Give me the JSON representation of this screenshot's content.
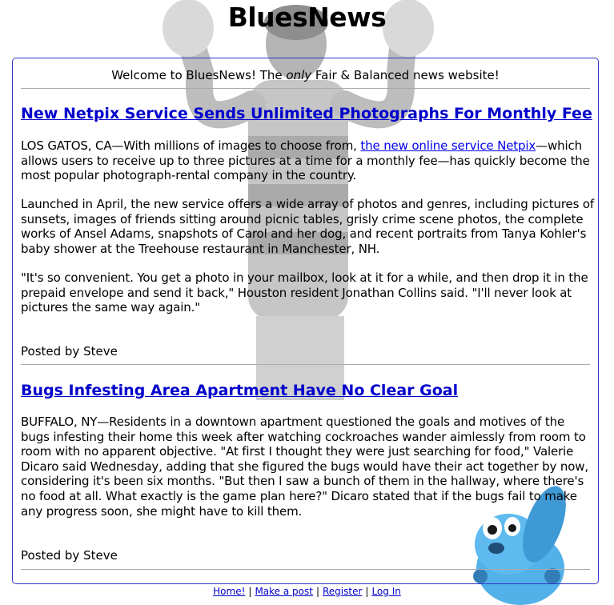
{
  "site": {
    "title": "BluesNews",
    "welcome_pre": "Welcome to BluesNews! The ",
    "welcome_em": "only",
    "welcome_post": " Fair & Balanced news website!"
  },
  "posts": [
    {
      "headline": "New Netpix Service Sends Unlimited Photographs For Monthly Fee",
      "p1_pre": "LOS GATOS, CA—With millions of images to choose from, ",
      "p1_link": "the new online service Netpix",
      "p1_post": "—which allows users to receive up to three pictures at a time for a monthly fee—has quickly become the most popular photograph-rental company in the country.",
      "p2": "Launched in April, the new service offers a wide array of photos and genres, including pictures of sunsets, images of friends sitting around picnic tables, grisly crime scene photos, the complete works of Ansel Adams, snapshots of Carol and her dog, and recent portraits from Tanya Kohler's baby shower at the Treehouse restaurant in Manchester, NH.",
      "p3": "\"It's so convenient. You get a photo in your mailbox, look at it for a while, and then drop it in the prepaid envelope and send it back,\" Houston resident Jonathan Collins said. \"I'll never look at pictures the same way again.\"",
      "posted_by": "Posted by Steve"
    },
    {
      "headline": "Bugs Infesting Area Apartment Have No Clear Goal",
      "p1": "BUFFALO, NY—Residents in a downtown apartment questioned the goals and motives of the bugs infesting their home this week after watching cockroaches wander aimlessly from room to room with no apparent objective. \"At first I thought they were just searching for food,\" Valerie Dicaro said Wednesday, adding that she figured the bugs would have their act together by now, considering it's been six months. \"But then I saw a bunch of them in the hallway, where there's no food at all. What exactly is the game plan here?\" Dicaro stated that if the bugs fail to make any progress soon, she might have to kill them.",
      "posted_by": "Posted by Steve"
    }
  ],
  "footer": {
    "home": "Home!",
    "make_post": "Make a post",
    "register": "Register",
    "login": "Log In",
    "separator": "|"
  },
  "colors": {
    "link": "#0000cc",
    "border": "#3333cc",
    "dog_blue": "#3fa9e6"
  }
}
